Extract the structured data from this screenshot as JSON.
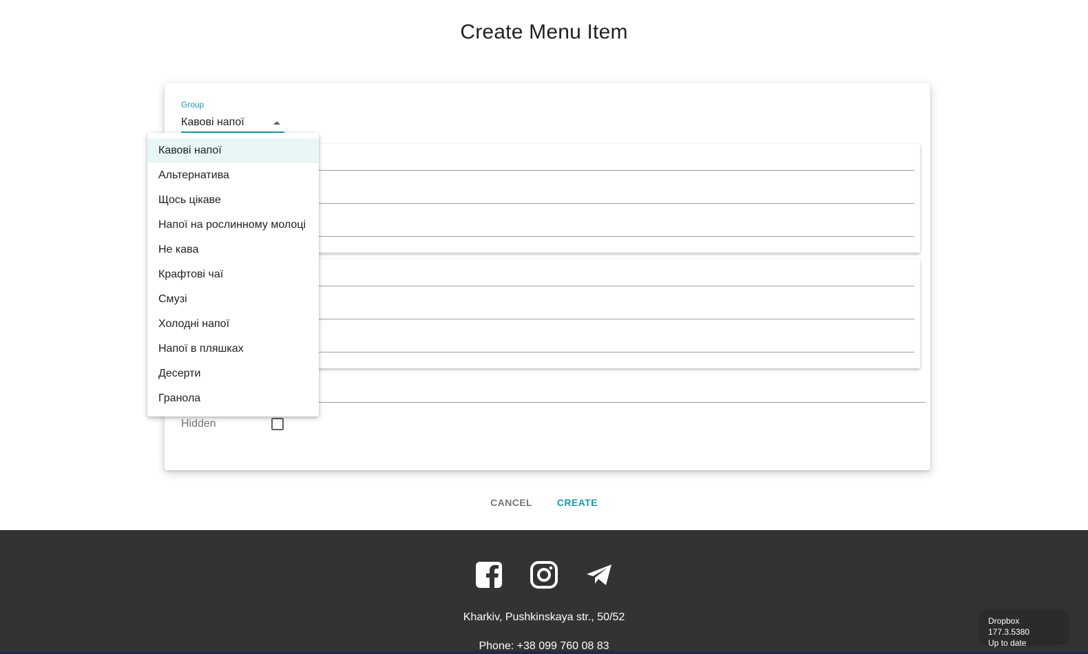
{
  "page": {
    "title": "Create Menu Item"
  },
  "form": {
    "group_label": "Group",
    "group_value": "Кавові напої",
    "hidden_label": "Hidden",
    "hidden_checked": false
  },
  "dropdown": {
    "options": [
      "Кавові напої",
      "Альтернатива",
      "Щось цікаве",
      "Напої на рослинному молоці",
      "Не кава",
      "Крафтові чаї",
      "Смузі",
      "Холодні напої",
      "Напої в пляшках",
      "Десерти",
      "Гранола"
    ],
    "selected_index": 0
  },
  "actions": {
    "cancel": "CANCEL",
    "create": "CREATE"
  },
  "footer": {
    "social_icons": [
      "facebook-icon",
      "instagram-icon",
      "telegram-icon"
    ],
    "address": "Kharkiv, Pushkinskaya str., 50/52",
    "phone": "Phone: +38 099 760 08 83"
  },
  "toast": {
    "title": "Dropbox 177.3.5380",
    "status": "Up to date"
  },
  "colors": {
    "accent": "#1a9aa8",
    "footer_bg": "#333333",
    "selected_option_bg": "#e8f6f6"
  }
}
